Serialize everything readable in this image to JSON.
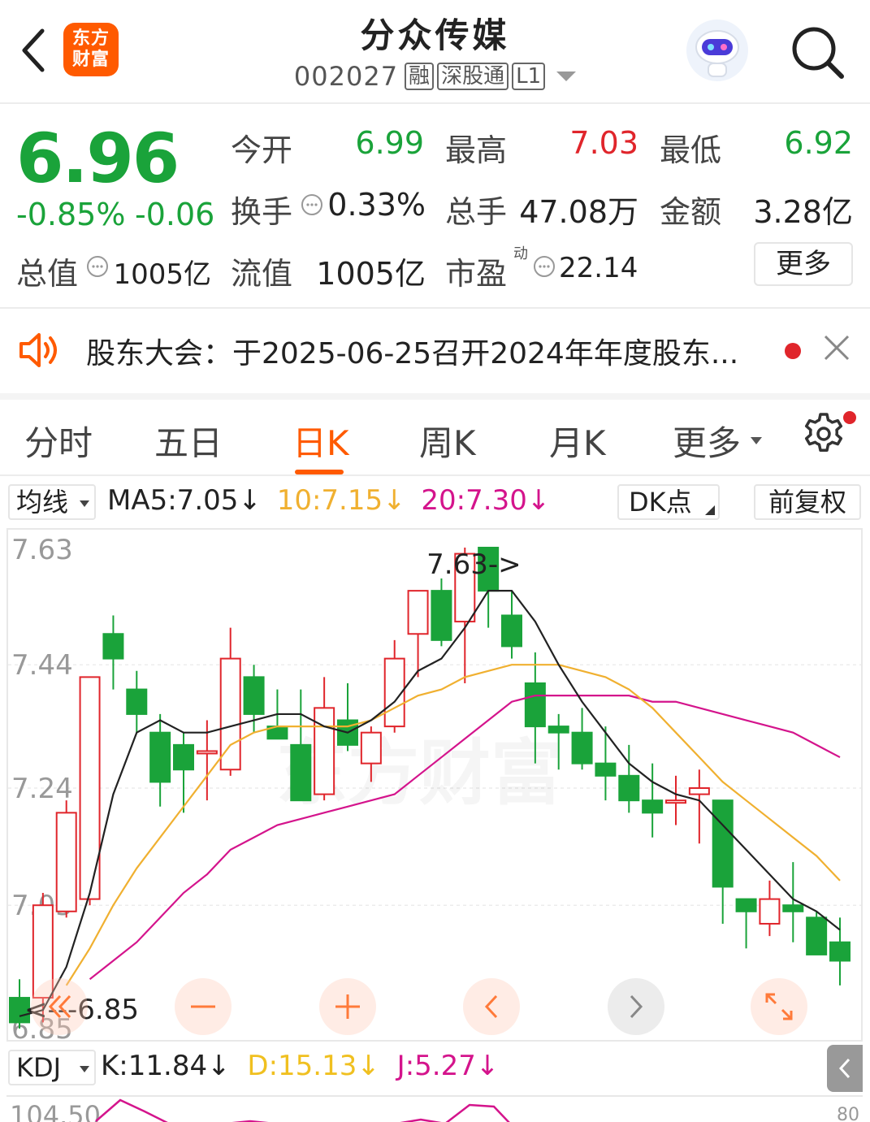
{
  "header": {
    "logo_line1": "东方",
    "logo_line2": "财富",
    "title": "分众传媒",
    "code": "002027",
    "tags": [
      "融",
      "深股通",
      "L1"
    ]
  },
  "quote": {
    "price": "6.96",
    "change_pct": "-0.85%",
    "change_abs": "-0.06",
    "fields": {
      "open_label": "今开",
      "open_val": "6.99",
      "high_label": "最高",
      "high_val": "7.03",
      "low_label": "最低",
      "low_val": "6.92",
      "turnover_label": "换手",
      "turnover_val": "0.33%",
      "volume_label": "总手",
      "volume_val": "47.08万",
      "amount_label": "金额",
      "amount_val": "3.28亿",
      "mktcap_label": "总值",
      "mktcap_val": "1005亿",
      "float_label": "流值",
      "float_val": "1005亿",
      "pe_label": "市盈",
      "pe_sup": "动",
      "pe_val": "22.14"
    },
    "more_label": "更多"
  },
  "notice": {
    "text": "股东大会：于2025-06-25召开2024年年度股东..."
  },
  "tabs": [
    "分时",
    "五日",
    "日K",
    "周K",
    "月K",
    "更多"
  ],
  "active_tab": "日K",
  "indicator": {
    "select_label": "均线",
    "ma5": "MA5:7.05↓",
    "ma10": "10:7.15↓",
    "ma20": "20:7.30↓",
    "dk_label": "DK点",
    "adjust_label": "前复权"
  },
  "chart_data": {
    "type": "candlestick",
    "y_ticks": [
      "7.63",
      "7.44",
      "7.24",
      "7.05",
      "6.85"
    ],
    "ylim": [
      6.85,
      7.63
    ],
    "high_marker": "7.63->",
    "low_marker": "<---6.85",
    "watermark": "东方财富",
    "colors": {
      "up": "#e0252b",
      "down": "#1aa33a",
      "ma5": "#222222",
      "ma10": "#f0b030",
      "ma20": "#d4148c"
    },
    "candles": [
      {
        "o": 6.9,
        "h": 6.93,
        "l": 6.85,
        "c": 6.86
      },
      {
        "o": 6.9,
        "h": 7.07,
        "l": 6.86,
        "c": 7.05
      },
      {
        "o": 7.04,
        "h": 7.22,
        "l": 7.03,
        "c": 7.2
      },
      {
        "o": 7.06,
        "h": 7.42,
        "l": 7.05,
        "c": 7.42
      },
      {
        "o": 7.49,
        "h": 7.52,
        "l": 7.4,
        "c": 7.45
      },
      {
        "o": 7.4,
        "h": 7.43,
        "l": 7.33,
        "c": 7.36
      },
      {
        "o": 7.33,
        "h": 7.36,
        "l": 7.21,
        "c": 7.25
      },
      {
        "o": 7.31,
        "h": 7.33,
        "l": 7.2,
        "c": 7.27
      },
      {
        "o": 7.3,
        "h": 7.35,
        "l": 7.22,
        "c": 7.3
      },
      {
        "o": 7.27,
        "h": 7.5,
        "l": 7.26,
        "c": 7.45
      },
      {
        "o": 7.42,
        "h": 7.44,
        "l": 7.33,
        "c": 7.36
      },
      {
        "o": 7.34,
        "h": 7.4,
        "l": 7.33,
        "c": 7.32
      },
      {
        "o": 7.31,
        "h": 7.4,
        "l": 7.22,
        "c": 7.22
      },
      {
        "o": 7.23,
        "h": 7.42,
        "l": 7.22,
        "c": 7.37
      },
      {
        "o": 7.35,
        "h": 7.41,
        "l": 7.3,
        "c": 7.31
      },
      {
        "o": 7.28,
        "h": 7.34,
        "l": 7.25,
        "c": 7.33
      },
      {
        "o": 7.34,
        "h": 7.48,
        "l": 7.33,
        "c": 7.45
      },
      {
        "o": 7.49,
        "h": 7.53,
        "l": 7.42,
        "c": 7.56
      },
      {
        "o": 7.56,
        "h": 7.58,
        "l": 7.47,
        "c": 7.48
      },
      {
        "o": 7.51,
        "h": 7.63,
        "l": 7.41,
        "c": 7.62
      },
      {
        "o": 7.63,
        "h": 7.63,
        "l": 7.5,
        "c": 7.56
      },
      {
        "o": 7.52,
        "h": 7.56,
        "l": 7.45,
        "c": 7.47
      },
      {
        "o": 7.41,
        "h": 7.46,
        "l": 7.28,
        "c": 7.34
      },
      {
        "o": 7.34,
        "h": 7.36,
        "l": 7.27,
        "c": 7.33
      },
      {
        "o": 7.33,
        "h": 7.37,
        "l": 7.27,
        "c": 7.28
      },
      {
        "o": 7.28,
        "h": 7.34,
        "l": 7.22,
        "c": 7.26
      },
      {
        "o": 7.26,
        "h": 7.31,
        "l": 7.2,
        "c": 7.22
      },
      {
        "o": 7.22,
        "h": 7.28,
        "l": 7.16,
        "c": 7.2
      },
      {
        "o": 7.22,
        "h": 7.26,
        "l": 7.18,
        "c": 7.22
      },
      {
        "o": 7.23,
        "h": 7.27,
        "l": 7.15,
        "c": 7.24
      },
      {
        "o": 7.22,
        "h": 7.22,
        "l": 7.02,
        "c": 7.08
      },
      {
        "o": 7.06,
        "h": 7.06,
        "l": 6.98,
        "c": 7.04
      },
      {
        "o": 7.02,
        "h": 7.09,
        "l": 7.0,
        "c": 7.06
      },
      {
        "o": 7.05,
        "h": 7.12,
        "l": 6.99,
        "c": 7.04
      },
      {
        "o": 7.03,
        "h": 7.04,
        "l": 6.99,
        "c": 6.97
      },
      {
        "o": 6.99,
        "h": 7.03,
        "l": 6.92,
        "c": 6.96
      }
    ],
    "ma5": [
      6.87,
      6.88,
      6.95,
      7.07,
      7.23,
      7.33,
      7.35,
      7.33,
      7.33,
      7.34,
      7.35,
      7.36,
      7.36,
      7.34,
      7.33,
      7.35,
      7.38,
      7.43,
      7.45,
      7.5,
      7.56,
      7.56,
      7.51,
      7.44,
      7.38,
      7.33,
      7.28,
      7.25,
      7.23,
      7.22,
      7.18,
      7.14,
      7.1,
      7.06,
      7.04,
      7.01
    ],
    "ma10": [
      null,
      null,
      6.92,
      6.98,
      7.05,
      7.11,
      7.16,
      7.21,
      7.26,
      7.31,
      7.33,
      7.34,
      7.34,
      7.34,
      7.34,
      7.35,
      7.37,
      7.39,
      7.4,
      7.42,
      7.43,
      7.44,
      7.44,
      7.44,
      7.43,
      7.42,
      7.4,
      7.37,
      7.33,
      7.29,
      7.25,
      7.22,
      7.19,
      7.16,
      7.13,
      7.09
    ],
    "ma20": [
      null,
      null,
      null,
      6.93,
      6.96,
      6.99,
      7.03,
      7.07,
      7.1,
      7.14,
      7.16,
      7.18,
      7.19,
      7.2,
      7.21,
      7.22,
      7.23,
      7.26,
      7.29,
      7.32,
      7.35,
      7.38,
      7.39,
      7.39,
      7.39,
      7.39,
      7.39,
      7.38,
      7.38,
      7.37,
      7.36,
      7.35,
      7.34,
      7.33,
      7.31,
      7.29
    ]
  },
  "kdj": {
    "select_label": "KDJ",
    "k": "K:11.84↓",
    "d": "D:15.13↓",
    "j": "J:5.27↓",
    "y_top": "104.50",
    "y_right": "80"
  }
}
